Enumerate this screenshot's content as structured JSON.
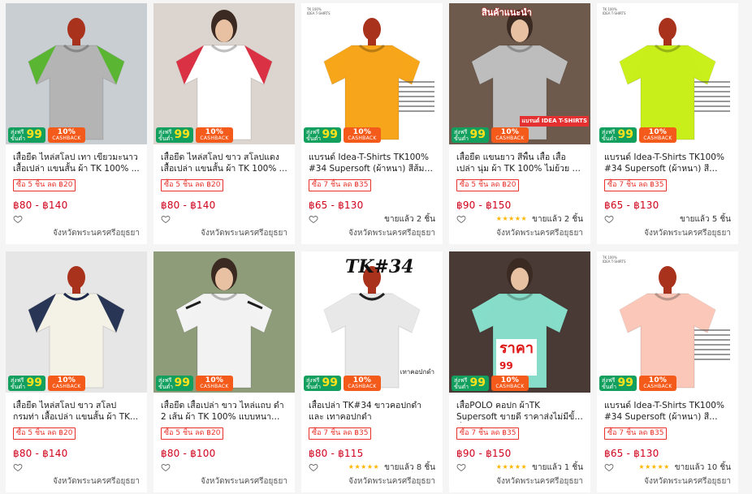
{
  "badges": {
    "free_ship_line1": "ส่งฟรี",
    "free_ship_line2": "ขั้นต่ำ",
    "free_ship_amount": "99",
    "cashback_pct": "10%",
    "cashback_label": "CASHBACK"
  },
  "products": [
    {
      "title": "เสื้อยืด ไหล่สโลป เทา เขียวมะนาว เสื้อเปล่า แขนสั้น ผ้า TK 100% ...",
      "discount": "ซื้อ 5 ชิ้น ลด ฿20",
      "price": "฿80 - ฿140",
      "stars": "",
      "sold": "",
      "location": "จังหวัดพระนครศรีอยุธยา",
      "colors": {
        "bg": "#c9ced3",
        "body": "#b4b4b4",
        "accent": "#55b52c"
      }
    },
    {
      "title": "เสื้อยืด ไหล่สโลป ขาว สโลปแดง เสื้อเปล่า แขนสั้น ผ้า TK 100% ...",
      "discount": "ซื้อ 5 ชิ้น ลด ฿20",
      "price": "฿80 - ฿140",
      "stars": "",
      "sold": "",
      "location": "จังหวัดพระนครศรีอยุธยา",
      "colors": {
        "bg": "#dcd4cf",
        "body": "#ffffff",
        "accent": "#d8273a"
      }
    },
    {
      "title": "แบรนด์ Idea-T-Shirts TK100% #34 Supersoft (ผ้าหนา) สีส้ม T...",
      "discount": "ซื้อ 7 ชิ้น ลด ฿35",
      "price": "฿65 - ฿130",
      "stars": "",
      "sold": "ขายแล้ว 2 ชิ้น",
      "location": "จังหวัดพระนครศรีอยุธยา",
      "colors": {
        "bg": "#ffffff",
        "body": "#f7a51a",
        "accent": "#f7a51a"
      }
    },
    {
      "title": "เสื้อยืด แขนยาว สีพื้น เสื้อ เสื้อเปล่า นุ่ม ผ้า TK 100% ไม่ย้วย ยับยาก...",
      "discount": "ซื้อ 5 ชิ้น ลด ฿20",
      "price": "฿90 - ฿150",
      "stars": "★★★★★",
      "sold": "ขายแล้ว 2 ชิ้น",
      "location": "จังหวัดพระนครศรีอยุธยา",
      "colors": {
        "bg": "#6d5a4c",
        "body": "#bdbdbd",
        "accent": "#e43030"
      }
    },
    {
      "title": "แบรนด์ Idea-T-Shirts TK100% #34 Supersoft (ผ้าหนา) สีเขียว...",
      "discount": "ซื้อ 7 ชิ้น ลด ฿35",
      "price": "฿65 - ฿130",
      "stars": "",
      "sold": "ขายแล้ว 5 ชิ้น",
      "location": "จังหวัดพระนครศรีอยุธยา",
      "colors": {
        "bg": "#ffffff",
        "body": "#c9ef1b",
        "accent": "#c9ef1b"
      }
    },
    {
      "title": "เสื้อยืด ไหล่สโลป ขาว สโลป กรมท่า เสื้อเปล่า แขนสั้น ผ้า TK...",
      "discount": "ซื้อ 5 ชิ้น ลด ฿20",
      "price": "฿80 - ฿140",
      "stars": "",
      "sold": "",
      "location": "จังหวัดพระนครศรีอยุธยา",
      "colors": {
        "bg": "#e6e6e6",
        "body": "#f4f1e6",
        "accent": "#1d2a4d"
      }
    },
    {
      "title": "เสื้อยืด เสื้อเปล่า ขาว ไหล่แถบ ดำ 2 เส้น ผ้า TK 100% แบบหนา นุ่...",
      "discount": "ซื้อ 5 ชิ้น ลด ฿20",
      "price": "฿80 - ฿100",
      "stars": "",
      "sold": "",
      "location": "จังหวัดพระนครศรีอยุธยา",
      "colors": {
        "bg": "#8e9c7a",
        "body": "#f2f2f2",
        "accent": "#1e1e1e"
      }
    },
    {
      "title": "เสื้อเปล่า TK#34 ขาวคอปกดำ และ เทาคอปกดำ",
      "discount": "ซื้อ 7 ชิ้น ลด ฿35",
      "price": "฿80 - ฿115",
      "stars": "★★★★★",
      "sold": "ขายแล้ว 8 ชิ้น",
      "location": "จังหวัดพระนครศรีอยุธยา",
      "colors": {
        "bg": "#ffffff",
        "body": "#e8e8e8",
        "accent": "#222222"
      }
    },
    {
      "title": "เสื้อPOLO คอปก ผ้าTK Supersoft ขายดี ราคาส่งไม่มีขั้นต่ำ",
      "discount": "ซื้อ 7 ชิ้น ลด ฿35",
      "price": "฿90 - ฿150",
      "stars": "★★★★★",
      "sold": "ขายแล้ว 1 ชิ้น",
      "location": "จังหวัดพระนครศรีอยุธยา",
      "colors": {
        "bg": "#4a3a36",
        "body": "#86dcc9",
        "accent": "#9ee34a"
      }
    },
    {
      "title": "แบรนด์ Idea-T-Shirts TK100% #34 Supersoft (ผ้าหนา) สีโอรส...",
      "discount": "ซื้อ 7 ชิ้น ลด ฿35",
      "price": "฿65 - ฿130",
      "stars": "★★★★★",
      "sold": "ขายแล้ว 10 ชิ้น",
      "location": "จังหวัดพระนครศรีอยุธยา",
      "colors": {
        "bg": "#ffffff",
        "body": "#fbc7b8",
        "accent": "#fbc7b8"
      }
    }
  ],
  "overlays": {
    "tk_tag": "TK 100%",
    "tk_sub": "IDEA T-SHIRTS",
    "tk34": "TK#34",
    "card4_banner": "สินค้าแนะนำ",
    "card4_caption": "แบรนด์ IDEA T-SHIRTS",
    "card8_caption": "เทาคอปกดำ",
    "card9_price_text": "ราคา",
    "card9_price_num": "99"
  }
}
